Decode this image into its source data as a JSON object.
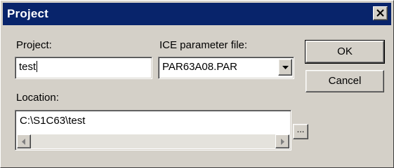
{
  "window": {
    "title": "Project",
    "close_icon": "close-icon"
  },
  "project": {
    "label": "Project:",
    "value": "test"
  },
  "ice": {
    "label": "ICE parameter file:",
    "value": "PAR63A08.PAR",
    "dropdown_icon": "chevron-down-icon"
  },
  "location": {
    "label": "Location:",
    "value": "C:\\S1C63\\test",
    "browse_label": "..."
  },
  "buttons": {
    "ok": "OK",
    "cancel": "Cancel"
  },
  "scrollbar": {
    "left_icon": "arrow-left-icon",
    "right_icon": "arrow-right-icon"
  }
}
